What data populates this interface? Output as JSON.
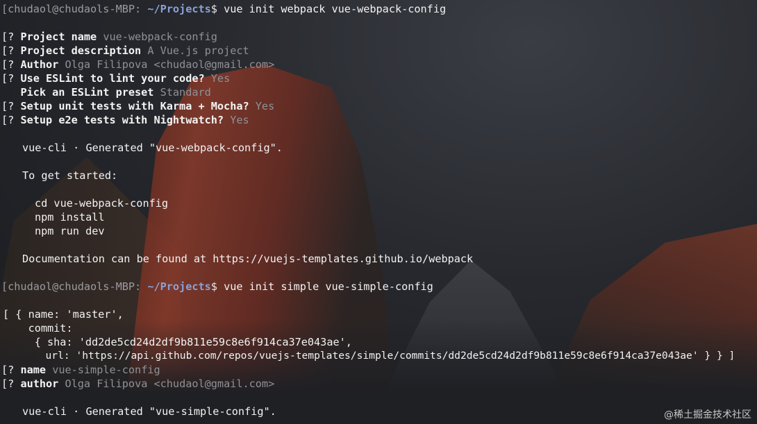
{
  "prompt1": {
    "host": "[chudaol@chudaols-MBP:",
    "path": "~/Projects",
    "dollar": "$",
    "command": "vue init webpack vue-webpack-config"
  },
  "questions1": [
    {
      "prefix": "[?",
      "q": "Project name",
      "a": "vue-webpack-config"
    },
    {
      "prefix": "[?",
      "q": "Project description",
      "a": "A Vue.js project"
    },
    {
      "prefix": "[?",
      "q": "Author",
      "a": "Olga Filipova <chudaol@gmail.com>"
    },
    {
      "prefix": "[?",
      "q": "Use ESLint to lint your code?",
      "a": "Yes"
    },
    {
      "prefix": "",
      "q": "Pick an ESLint preset",
      "a": "Standard"
    },
    {
      "prefix": "[?",
      "q": "Setup unit tests with Karma + Mocha?",
      "a": "Yes"
    },
    {
      "prefix": "[?",
      "q": "Setup e2e tests with Nightwatch?",
      "a": "Yes"
    }
  ],
  "generated1": {
    "prefix": "vue-cli · ",
    "text": "Generated \"vue-webpack-config\"."
  },
  "get_started": "To get started:",
  "steps": [
    "cd vue-webpack-config",
    "npm install",
    "npm run dev"
  ],
  "docs": "Documentation can be found at https://vuejs-templates.github.io/webpack",
  "prompt2": {
    "host": "[chudaol@chudaols-MBP:",
    "path": "~/Projects",
    "dollar": "$",
    "command": "vue init simple vue-simple-config"
  },
  "output2": [
    "[ { name: 'master',",
    "    commit:",
    "     { sha: 'dd2de5cd24d2df9b811e59c8e6f914ca37e043ae',",
    "       url: 'https://api.github.com/repos/vuejs-templates/simple/commits/dd2de5cd24d2df9b811e59c8e6f914ca37e043ae' } } ]"
  ],
  "questions2": [
    {
      "prefix": "[?",
      "q": "name",
      "a": "vue-simple-config"
    },
    {
      "prefix": "[?",
      "q": "author",
      "a": "Olga Filipova <chudaol@gmail.com>"
    }
  ],
  "generated2": {
    "prefix": "vue-cli · ",
    "text": "Generated \"vue-simple-config\"."
  },
  "watermark": "@稀土掘金技术社区"
}
